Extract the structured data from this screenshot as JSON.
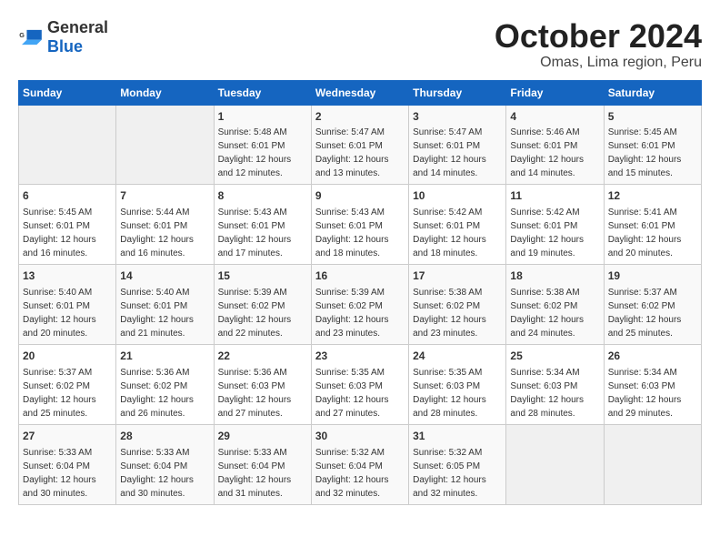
{
  "header": {
    "logo_general": "General",
    "logo_blue": "Blue",
    "title": "October 2024",
    "subtitle": "Omas, Lima region, Peru"
  },
  "days_of_week": [
    "Sunday",
    "Monday",
    "Tuesday",
    "Wednesday",
    "Thursday",
    "Friday",
    "Saturday"
  ],
  "weeks": [
    [
      {
        "day": "",
        "sunrise": "",
        "sunset": "",
        "daylight": "",
        "empty": true
      },
      {
        "day": "",
        "sunrise": "",
        "sunset": "",
        "daylight": "",
        "empty": true
      },
      {
        "day": "1",
        "sunrise": "Sunrise: 5:48 AM",
        "sunset": "Sunset: 6:01 PM",
        "daylight": "Daylight: 12 hours and 12 minutes."
      },
      {
        "day": "2",
        "sunrise": "Sunrise: 5:47 AM",
        "sunset": "Sunset: 6:01 PM",
        "daylight": "Daylight: 12 hours and 13 minutes."
      },
      {
        "day": "3",
        "sunrise": "Sunrise: 5:47 AM",
        "sunset": "Sunset: 6:01 PM",
        "daylight": "Daylight: 12 hours and 14 minutes."
      },
      {
        "day": "4",
        "sunrise": "Sunrise: 5:46 AM",
        "sunset": "Sunset: 6:01 PM",
        "daylight": "Daylight: 12 hours and 14 minutes."
      },
      {
        "day": "5",
        "sunrise": "Sunrise: 5:45 AM",
        "sunset": "Sunset: 6:01 PM",
        "daylight": "Daylight: 12 hours and 15 minutes."
      }
    ],
    [
      {
        "day": "6",
        "sunrise": "Sunrise: 5:45 AM",
        "sunset": "Sunset: 6:01 PM",
        "daylight": "Daylight: 12 hours and 16 minutes."
      },
      {
        "day": "7",
        "sunrise": "Sunrise: 5:44 AM",
        "sunset": "Sunset: 6:01 PM",
        "daylight": "Daylight: 12 hours and 16 minutes."
      },
      {
        "day": "8",
        "sunrise": "Sunrise: 5:43 AM",
        "sunset": "Sunset: 6:01 PM",
        "daylight": "Daylight: 12 hours and 17 minutes."
      },
      {
        "day": "9",
        "sunrise": "Sunrise: 5:43 AM",
        "sunset": "Sunset: 6:01 PM",
        "daylight": "Daylight: 12 hours and 18 minutes."
      },
      {
        "day": "10",
        "sunrise": "Sunrise: 5:42 AM",
        "sunset": "Sunset: 6:01 PM",
        "daylight": "Daylight: 12 hours and 18 minutes."
      },
      {
        "day": "11",
        "sunrise": "Sunrise: 5:42 AM",
        "sunset": "Sunset: 6:01 PM",
        "daylight": "Daylight: 12 hours and 19 minutes."
      },
      {
        "day": "12",
        "sunrise": "Sunrise: 5:41 AM",
        "sunset": "Sunset: 6:01 PM",
        "daylight": "Daylight: 12 hours and 20 minutes."
      }
    ],
    [
      {
        "day": "13",
        "sunrise": "Sunrise: 5:40 AM",
        "sunset": "Sunset: 6:01 PM",
        "daylight": "Daylight: 12 hours and 20 minutes."
      },
      {
        "day": "14",
        "sunrise": "Sunrise: 5:40 AM",
        "sunset": "Sunset: 6:01 PM",
        "daylight": "Daylight: 12 hours and 21 minutes."
      },
      {
        "day": "15",
        "sunrise": "Sunrise: 5:39 AM",
        "sunset": "Sunset: 6:02 PM",
        "daylight": "Daylight: 12 hours and 22 minutes."
      },
      {
        "day": "16",
        "sunrise": "Sunrise: 5:39 AM",
        "sunset": "Sunset: 6:02 PM",
        "daylight": "Daylight: 12 hours and 23 minutes."
      },
      {
        "day": "17",
        "sunrise": "Sunrise: 5:38 AM",
        "sunset": "Sunset: 6:02 PM",
        "daylight": "Daylight: 12 hours and 23 minutes."
      },
      {
        "day": "18",
        "sunrise": "Sunrise: 5:38 AM",
        "sunset": "Sunset: 6:02 PM",
        "daylight": "Daylight: 12 hours and 24 minutes."
      },
      {
        "day": "19",
        "sunrise": "Sunrise: 5:37 AM",
        "sunset": "Sunset: 6:02 PM",
        "daylight": "Daylight: 12 hours and 25 minutes."
      }
    ],
    [
      {
        "day": "20",
        "sunrise": "Sunrise: 5:37 AM",
        "sunset": "Sunset: 6:02 PM",
        "daylight": "Daylight: 12 hours and 25 minutes."
      },
      {
        "day": "21",
        "sunrise": "Sunrise: 5:36 AM",
        "sunset": "Sunset: 6:02 PM",
        "daylight": "Daylight: 12 hours and 26 minutes."
      },
      {
        "day": "22",
        "sunrise": "Sunrise: 5:36 AM",
        "sunset": "Sunset: 6:03 PM",
        "daylight": "Daylight: 12 hours and 27 minutes."
      },
      {
        "day": "23",
        "sunrise": "Sunrise: 5:35 AM",
        "sunset": "Sunset: 6:03 PM",
        "daylight": "Daylight: 12 hours and 27 minutes."
      },
      {
        "day": "24",
        "sunrise": "Sunrise: 5:35 AM",
        "sunset": "Sunset: 6:03 PM",
        "daylight": "Daylight: 12 hours and 28 minutes."
      },
      {
        "day": "25",
        "sunrise": "Sunrise: 5:34 AM",
        "sunset": "Sunset: 6:03 PM",
        "daylight": "Daylight: 12 hours and 28 minutes."
      },
      {
        "day": "26",
        "sunrise": "Sunrise: 5:34 AM",
        "sunset": "Sunset: 6:03 PM",
        "daylight": "Daylight: 12 hours and 29 minutes."
      }
    ],
    [
      {
        "day": "27",
        "sunrise": "Sunrise: 5:33 AM",
        "sunset": "Sunset: 6:04 PM",
        "daylight": "Daylight: 12 hours and 30 minutes."
      },
      {
        "day": "28",
        "sunrise": "Sunrise: 5:33 AM",
        "sunset": "Sunset: 6:04 PM",
        "daylight": "Daylight: 12 hours and 30 minutes."
      },
      {
        "day": "29",
        "sunrise": "Sunrise: 5:33 AM",
        "sunset": "Sunset: 6:04 PM",
        "daylight": "Daylight: 12 hours and 31 minutes."
      },
      {
        "day": "30",
        "sunrise": "Sunrise: 5:32 AM",
        "sunset": "Sunset: 6:04 PM",
        "daylight": "Daylight: 12 hours and 32 minutes."
      },
      {
        "day": "31",
        "sunrise": "Sunrise: 5:32 AM",
        "sunset": "Sunset: 6:05 PM",
        "daylight": "Daylight: 12 hours and 32 minutes."
      },
      {
        "day": "",
        "sunrise": "",
        "sunset": "",
        "daylight": "",
        "empty": true
      },
      {
        "day": "",
        "sunrise": "",
        "sunset": "",
        "daylight": "",
        "empty": true
      }
    ]
  ]
}
